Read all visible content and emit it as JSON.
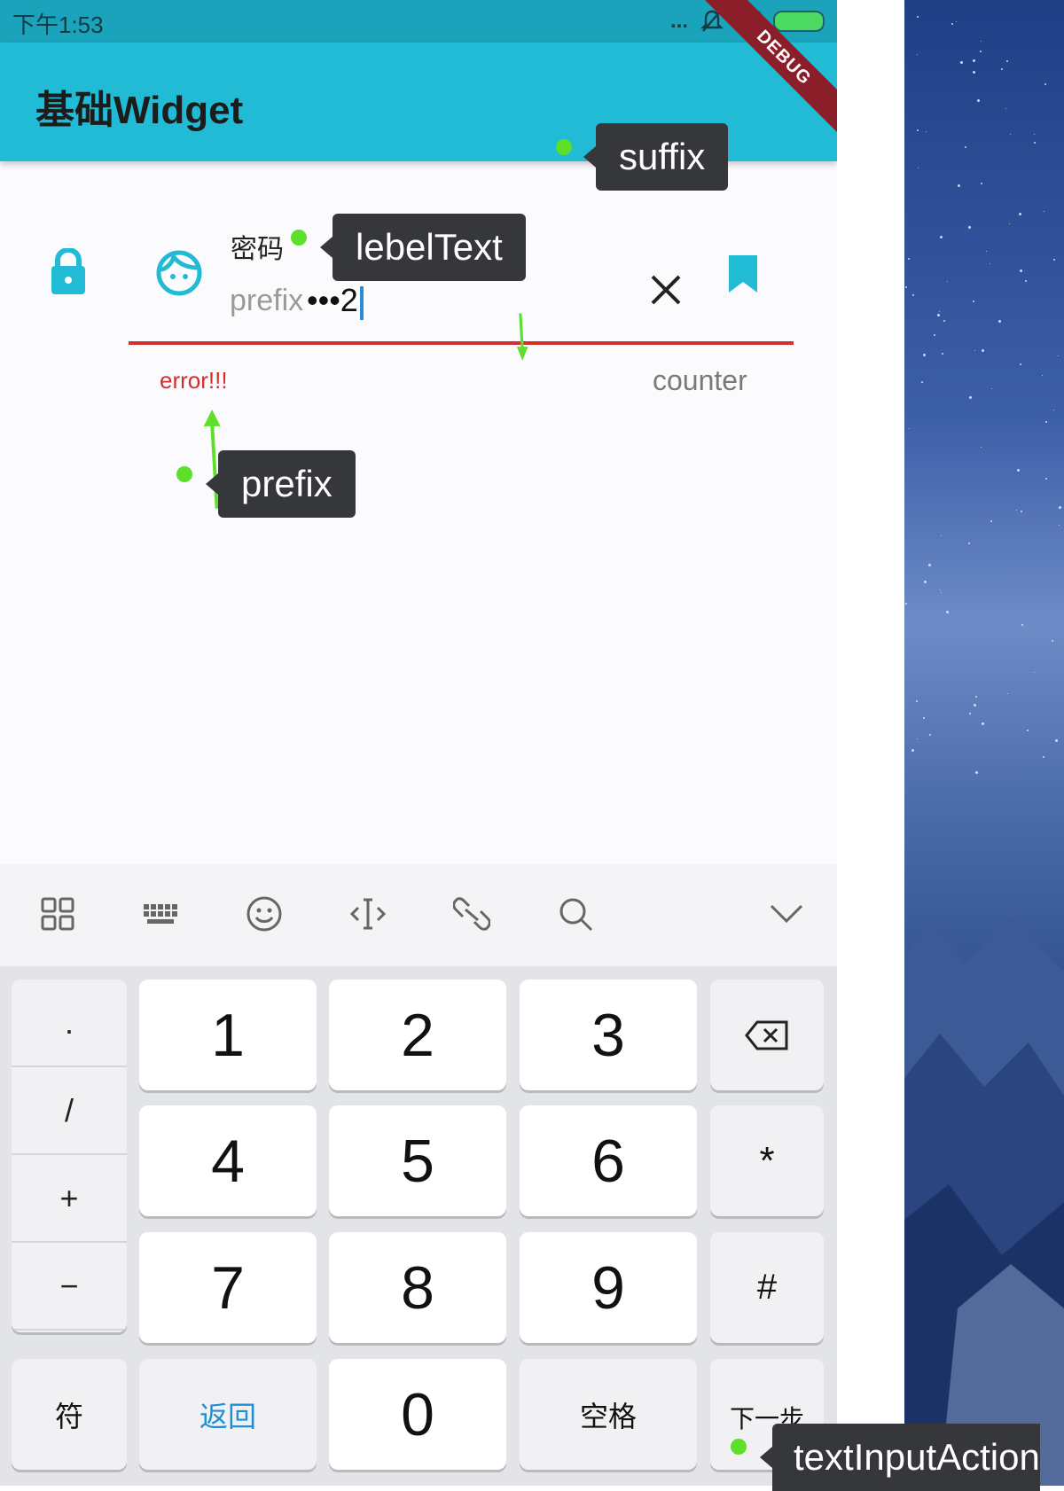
{
  "status_bar": {
    "time": "下午1:53",
    "dots": "..."
  },
  "app_bar": {
    "title": "基础Widget",
    "debug_banner": "DEBUG"
  },
  "text_field": {
    "label": "密码",
    "prefix": "prefix",
    "value": "•••2",
    "error": "error!!!",
    "counter": "counter",
    "prefix_icon": "lock-icon",
    "icon": "face-icon",
    "suffix_icon": "close-icon",
    "suffix_trailing_icon": "bookmark-icon",
    "error_color": "#d32f2f",
    "accent_color": "#22bbd5"
  },
  "annotations": {
    "label_text": "lebelText",
    "suffix": "suffix",
    "prefix": "prefix",
    "text_input_action": "textInputAction",
    "dot_color": "#5de02a"
  },
  "keyboard_toolbar": {
    "icons": [
      "grid-icon",
      "keyboard-icon",
      "emoji-icon",
      "cursor-move-icon",
      "link-icon",
      "search-icon",
      "chevron-down-icon"
    ]
  },
  "keyboard": {
    "symbols": [
      ".",
      "/",
      "+",
      "−"
    ],
    "digits_row1": [
      "1",
      "2",
      "3"
    ],
    "digits_row2": [
      "4",
      "5",
      "6"
    ],
    "digits_row3": [
      "7",
      "8",
      "9"
    ],
    "backspace_icon": "backspace-icon",
    "star": "*",
    "hash": "#",
    "fu": "符",
    "back": "返回",
    "zero": "0",
    "space": "空格",
    "next": "下一步"
  }
}
